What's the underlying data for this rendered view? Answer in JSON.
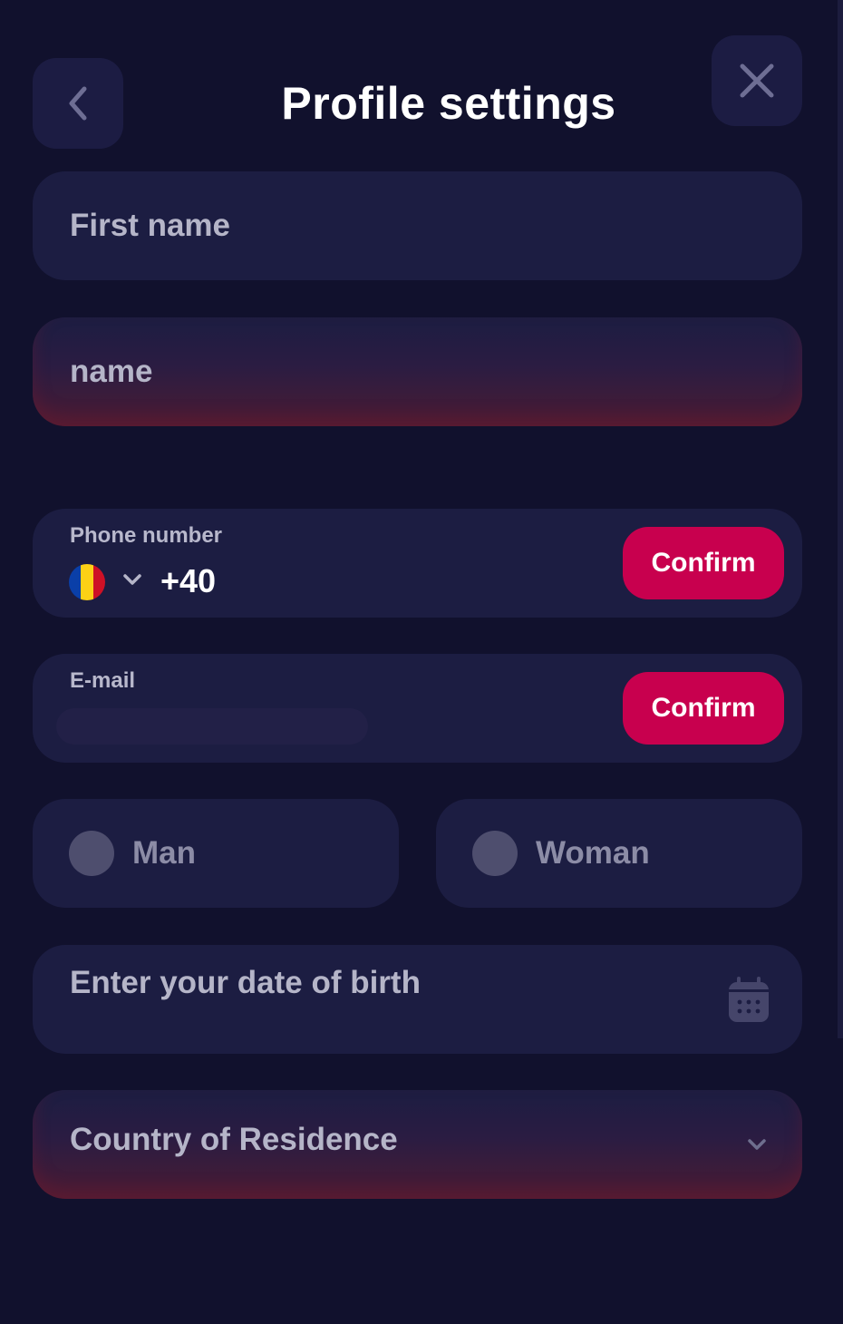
{
  "header": {
    "title": "Profile settings",
    "back_icon": "chevron-left-icon",
    "close_icon": "close-icon"
  },
  "form": {
    "first_name": {
      "placeholder": "First name"
    },
    "last_name": {
      "placeholder": "name",
      "state": "error"
    },
    "phone": {
      "label": "Phone number",
      "country_flag": "Romania",
      "flag_colors": [
        "#0a3fa8",
        "#fcd116",
        "#ce1126"
      ],
      "code": "+40",
      "confirm_label": "Confirm"
    },
    "email": {
      "label": "E-mail",
      "confirm_label": "Confirm"
    },
    "gender": {
      "options": [
        {
          "label": "Man",
          "selected": false
        },
        {
          "label": "Woman",
          "selected": false
        }
      ]
    },
    "date_of_birth": {
      "placeholder": "Enter your date of birth",
      "icon": "calendar-icon"
    },
    "country": {
      "placeholder": "Country of Residence",
      "state": "error",
      "icon": "chevron-down-icon"
    }
  },
  "colors": {
    "background": "#11112d",
    "field": "#1c1d42",
    "accent": "#c8004e",
    "error_glow": "#4a1b33"
  }
}
